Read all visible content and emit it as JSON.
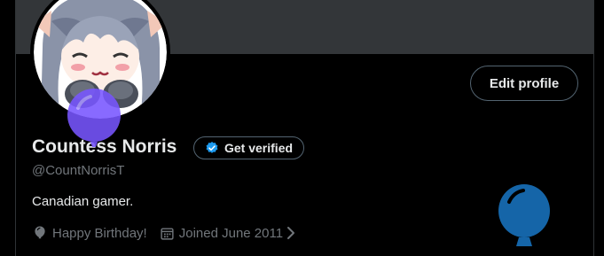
{
  "profile": {
    "display_name": "Countess Norris",
    "handle": "@CountNorrisT",
    "bio": "Canadian gamer.",
    "birthday": "Happy Birthday!",
    "joined": "Joined June 2011"
  },
  "actions": {
    "edit_profile_label": "Edit profile",
    "get_verified_label": "Get verified"
  },
  "icons": {
    "verified": "verified-badge-icon",
    "birthday": "balloon-icon",
    "joined": "calendar-icon",
    "more": "chevron-right-icon"
  },
  "colors": {
    "background": "#000000",
    "banner": "#333639",
    "primary_text": "#e7e9ea",
    "secondary_text": "#71767b",
    "border": "#536471",
    "verified_blue": "#1d9bf0",
    "balloon_purple": "#7856ff",
    "balloon_blue": "#1565a8"
  }
}
